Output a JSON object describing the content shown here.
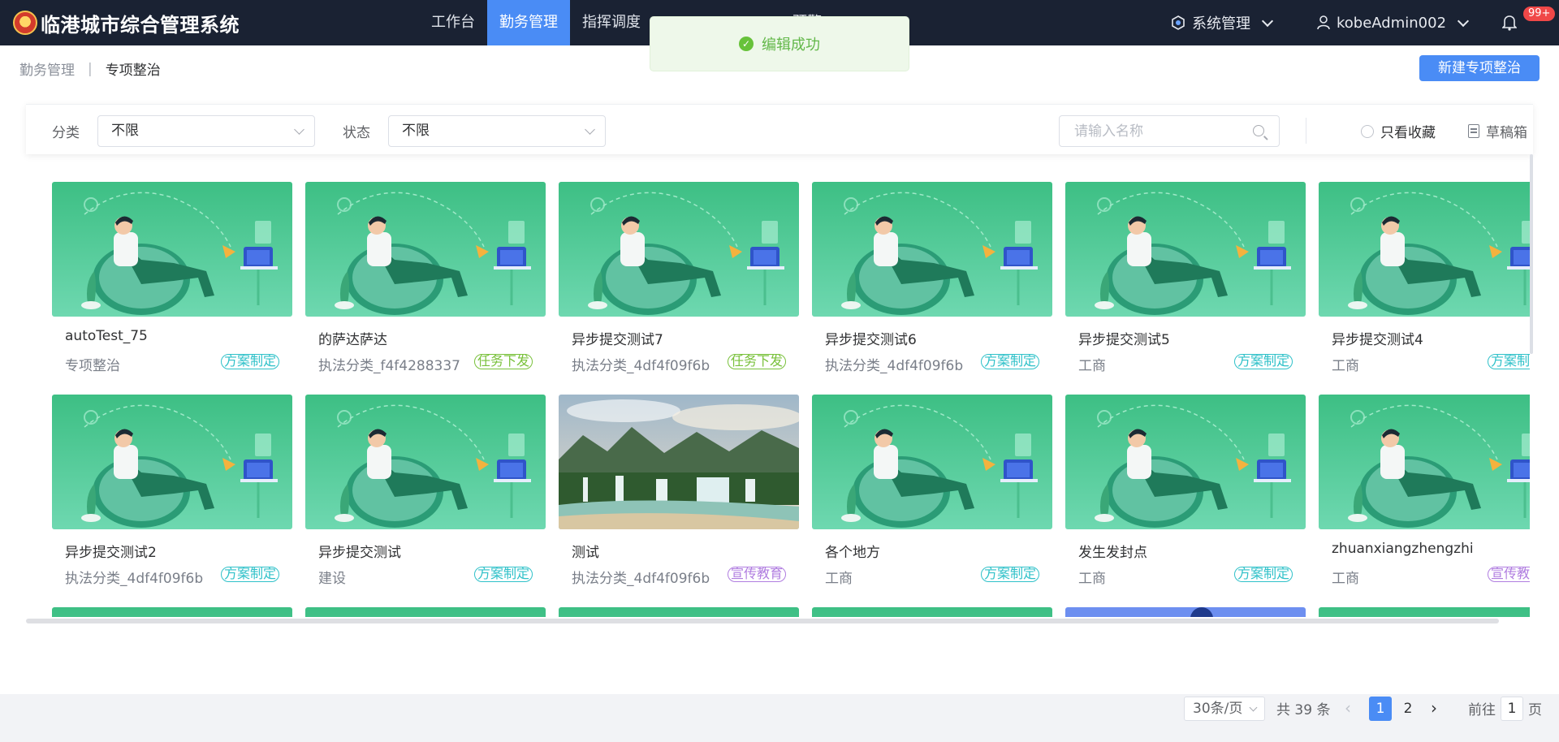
{
  "app": {
    "title": "临港城市综合管理系统"
  },
  "nav": [
    {
      "label": "工作台",
      "active": false
    },
    {
      "label": "勤务管理",
      "active": true
    },
    {
      "label": "指挥调度",
      "active": false
    },
    {
      "label": "预警",
      "active": false
    }
  ],
  "header": {
    "system_menu": "系统管理",
    "username": "kobeAdmin002",
    "notification_count": "99+"
  },
  "toast": {
    "message": "编辑成功"
  },
  "breadcrumb": {
    "parent": "勤务管理",
    "separator": "|",
    "current": "专项整治"
  },
  "actions": {
    "create_label": "新建专项整治"
  },
  "filters": {
    "category_label": "分类",
    "category_value": "不限",
    "status_label": "状态",
    "status_value": "不限",
    "search_placeholder": "请输入名称",
    "favorites_label": "只看收藏",
    "drafts_label": "草稿箱"
  },
  "cards": [
    {
      "name": "autoTest_75",
      "category": "专项整治",
      "tag": "方案制定",
      "tag_type": "plan",
      "image": "illustration"
    },
    {
      "name": "的萨达萨达",
      "category": "执法分类_f4f4288337",
      "tag": "任务下发",
      "tag_type": "task",
      "image": "illustration"
    },
    {
      "name": "异步提交测试7",
      "category": "执法分类_4df4f09f6b",
      "tag": "任务下发",
      "tag_type": "task",
      "image": "illustration"
    },
    {
      "name": "异步提交测试6",
      "category": "执法分类_4df4f09f6b",
      "tag": "方案制定",
      "tag_type": "plan",
      "image": "illustration"
    },
    {
      "name": "异步提交测试5",
      "category": "工商",
      "tag": "方案制定",
      "tag_type": "plan",
      "image": "illustration"
    },
    {
      "name": "异步提交测试4",
      "category": "工商",
      "tag": "方案制定",
      "tag_type": "plan",
      "image": "illustration"
    },
    {
      "name": "异步提交测试2",
      "category": "执法分类_4df4f09f6b",
      "tag": "方案制定",
      "tag_type": "plan",
      "image": "illustration"
    },
    {
      "name": "异步提交测试",
      "category": "建设",
      "tag": "方案制定",
      "tag_type": "plan",
      "image": "illustration"
    },
    {
      "name": "测试",
      "category": "执法分类_4df4f09f6b",
      "tag": "宣传教育",
      "tag_type": "promo",
      "image": "landscape"
    },
    {
      "name": "各个地方",
      "category": "工商",
      "tag": "方案制定",
      "tag_type": "plan",
      "image": "illustration"
    },
    {
      "name": "发生发封点",
      "category": "工商",
      "tag": "方案制定",
      "tag_type": "plan",
      "image": "illustration"
    },
    {
      "name": "zhuanxiangzhengzhi",
      "category": "工商",
      "tag": "宣传教育",
      "tag_type": "promo",
      "image": "illustration"
    }
  ],
  "partial_row": [
    {
      "image": "illustration"
    },
    {
      "image": "illustration"
    },
    {
      "image": "illustration"
    },
    {
      "image": "illustration"
    },
    {
      "image": "blue"
    },
    {
      "image": "illustration"
    }
  ],
  "pagination": {
    "page_size": "30条/页",
    "total": "共 39 条",
    "pages": [
      "1",
      "2"
    ],
    "current": "1",
    "goto_label": "前往",
    "goto_value": "1",
    "page_suffix": "页"
  },
  "colors": {
    "header_bg": "#1a2233",
    "accent": "#4a8cf5",
    "tag_plan": "#2fc1c9",
    "tag_task": "#79c13b",
    "tag_promo": "#b07de0",
    "success": "#67c23a"
  }
}
